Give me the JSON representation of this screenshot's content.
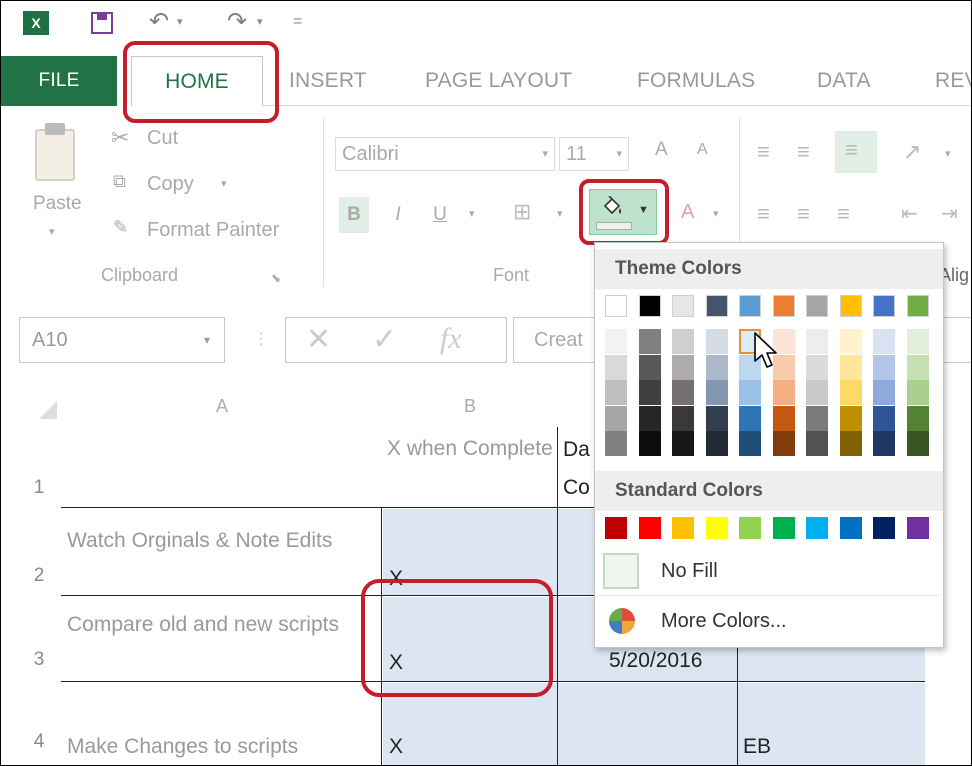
{
  "qat": {
    "app_icon": "X",
    "undo_label": "↶",
    "redo_label": "↷",
    "more_label": "="
  },
  "tabs": [
    "FILE",
    "HOME",
    "INSERT",
    "PAGE LAYOUT",
    "FORMULAS",
    "DATA",
    "REV"
  ],
  "clipboard": {
    "paste": "Paste",
    "cut": "Cut",
    "copy": "Copy",
    "format_painter": "Format Painter",
    "group": "Clipboard"
  },
  "font": {
    "name": "Calibri",
    "size": "11",
    "group": "Font",
    "bold": "B",
    "italic": "I",
    "underline": "U",
    "grow": "A",
    "shrink": "A"
  },
  "alignment": {
    "group_partial": "Alig"
  },
  "formula_bar": {
    "name_box": "A10",
    "fx": "fx",
    "content_partial": "Creat"
  },
  "columns": [
    "A",
    "B"
  ],
  "rows": [
    {
      "num": "1",
      "a": "",
      "b": "X when Complete",
      "c": "Da Co"
    },
    {
      "num": "2",
      "a": "Watch Orginals & Note Edits",
      "b": "X",
      "c": ""
    },
    {
      "num": "3",
      "a": "Compare old and new scripts",
      "b": "X",
      "c": "5/20/2016"
    },
    {
      "num": "4",
      "a": "Make Changes to scripts",
      "b": "X",
      "c": "",
      "d": "EB"
    }
  ],
  "fill_menu": {
    "theme_title": "Theme Colors",
    "standard_title": "Standard Colors",
    "no_fill": "No Fill",
    "more_colors": "More Colors...",
    "theme_top": [
      "#ffffff",
      "#000000",
      "#e7e6e6",
      "#44546a",
      "#5b9bd5",
      "#ed7d31",
      "#a5a5a5",
      "#ffc000",
      "#4472c4",
      "#70ad47"
    ],
    "theme_shades": [
      [
        "#f2f2f2",
        "#d9d9d9",
        "#bfbfbf",
        "#a6a6a6",
        "#808080"
      ],
      [
        "#808080",
        "#595959",
        "#404040",
        "#262626",
        "#0d0d0d"
      ],
      [
        "#d0cece",
        "#aeabab",
        "#757171",
        "#3a3838",
        "#171616"
      ],
      [
        "#d6dce4",
        "#adb9ca",
        "#8497b0",
        "#333f4f",
        "#222a35"
      ],
      [
        "#ddebf7",
        "#bdd7ee",
        "#9bc2e6",
        "#2f75b5",
        "#1f4e78"
      ],
      [
        "#fce4d6",
        "#f8cbad",
        "#f4b084",
        "#c65911",
        "#833c0b"
      ],
      [
        "#ededed",
        "#dbdbdb",
        "#c9c9c9",
        "#7b7b7b",
        "#525252"
      ],
      [
        "#fff2cc",
        "#ffe699",
        "#ffd966",
        "#bf8f00",
        "#806000"
      ],
      [
        "#d9e1f2",
        "#b4c6e7",
        "#8ea9db",
        "#305496",
        "#203764"
      ],
      [
        "#e2efda",
        "#c6e0b4",
        "#a9d08e",
        "#548235",
        "#375623"
      ]
    ],
    "standard": [
      "#c00000",
      "#ff0000",
      "#ffc000",
      "#ffff00",
      "#92d050",
      "#00b050",
      "#00b0f0",
      "#0070c0",
      "#002060",
      "#7030a0"
    ]
  }
}
